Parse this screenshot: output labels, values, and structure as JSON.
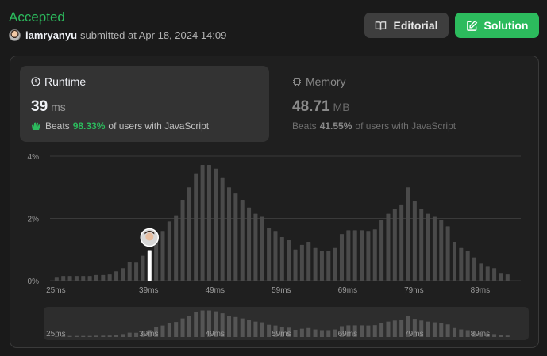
{
  "submission": {
    "status": "Accepted",
    "username": "iamryanyu",
    "submitted_text": "submitted at Apr 18, 2024 14:09"
  },
  "buttons": {
    "editorial": {
      "label": "Editorial",
      "icon": "book-icon"
    },
    "solution": {
      "label": "Solution",
      "icon": "edit-icon"
    }
  },
  "runtime": {
    "title": "Runtime",
    "value": "39",
    "unit": "ms",
    "beats_label": "Beats",
    "beats_pct": "98.33%",
    "beats_suffix": "of users with JavaScript"
  },
  "memory": {
    "title": "Memory",
    "value": "48.71",
    "unit": "MB",
    "beats_label": "Beats",
    "beats_pct": "41.55%",
    "beats_suffix": "of users with JavaScript"
  },
  "colors": {
    "accent": "#2cbb5d",
    "bar": "#4a4a4a",
    "bar_selected": "#ffffff",
    "mini_bar": "#555555"
  },
  "chart_data": {
    "type": "bar",
    "y_ticks": [
      "4%",
      "2%",
      "0%"
    ],
    "ylim": [
      0,
      4
    ],
    "x_tick_labels": [
      "25ms",
      "39ms",
      "49ms",
      "59ms",
      "69ms",
      "79ms",
      "89ms"
    ],
    "x_tick_values": [
      25,
      39,
      49,
      59,
      69,
      79,
      89
    ],
    "xlim": [
      24,
      95
    ],
    "selected_x": 39,
    "x": [
      25,
      26,
      27,
      28,
      29,
      30,
      31,
      32,
      33,
      34,
      35,
      36,
      37,
      38,
      39,
      40,
      41,
      42,
      43,
      44,
      45,
      46,
      47,
      48,
      49,
      50,
      51,
      52,
      53,
      54,
      55,
      56,
      57,
      58,
      59,
      60,
      61,
      62,
      63,
      64,
      65,
      66,
      67,
      68,
      69,
      70,
      71,
      72,
      73,
      74,
      75,
      76,
      77,
      78,
      79,
      80,
      81,
      82,
      83,
      84,
      85,
      86,
      87,
      88,
      89,
      90,
      91,
      92,
      93
    ],
    "values": [
      0.12,
      0.15,
      0.15,
      0.15,
      0.15,
      0.15,
      0.18,
      0.18,
      0.2,
      0.3,
      0.4,
      0.6,
      0.58,
      0.8,
      0.98,
      1.35,
      1.6,
      1.9,
      2.1,
      2.6,
      3.0,
      3.45,
      3.72,
      3.72,
      3.6,
      3.32,
      3.0,
      2.8,
      2.6,
      2.35,
      2.15,
      2.05,
      1.7,
      1.6,
      1.4,
      1.3,
      1.0,
      1.15,
      1.25,
      1.05,
      0.95,
      0.95,
      1.05,
      1.5,
      1.62,
      1.62,
      1.62,
      1.6,
      1.65,
      1.95,
      2.15,
      2.3,
      2.45,
      3.0,
      2.55,
      2.3,
      2.15,
      2.05,
      1.95,
      1.75,
      1.25,
      1.05,
      0.95,
      0.75,
      0.55,
      0.45,
      0.4,
      0.25,
      0.2
    ]
  }
}
